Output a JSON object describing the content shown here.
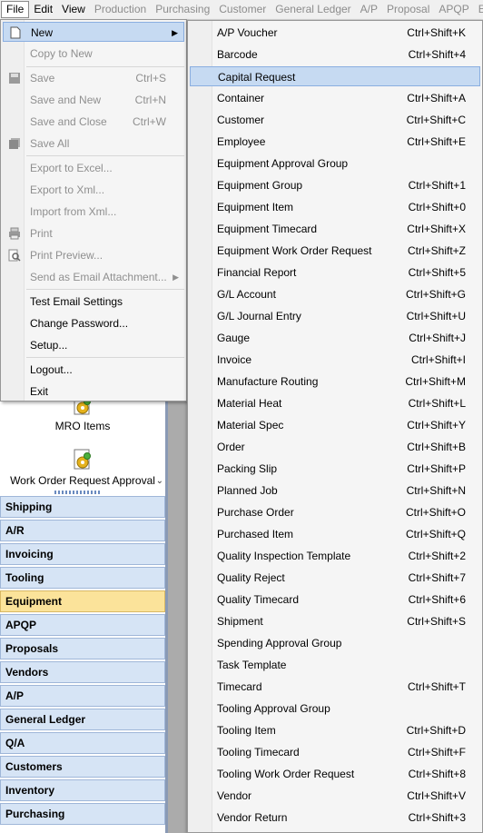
{
  "menubar": [
    "File",
    "Edit",
    "View",
    "Production",
    "Purchasing",
    "Customer",
    "General Ledger",
    "A/P",
    "Proposal",
    "APQP",
    "Eq"
  ],
  "menubar_disabled_from": 3,
  "file_menu": {
    "new": "New",
    "copy_to_new": "Copy to New",
    "save": "Save",
    "save_sc": "Ctrl+S",
    "save_new": "Save and New",
    "save_new_sc": "Ctrl+N",
    "save_close": "Save and Close",
    "save_close_sc": "Ctrl+W",
    "save_all": "Save All",
    "export_excel": "Export to Excel...",
    "export_xml": "Export to Xml...",
    "import_xml": "Import from Xml...",
    "print": "Print",
    "print_preview": "Print Preview...",
    "send_email": "Send as Email Attachment...",
    "test_email": "Test Email Settings",
    "change_password": "Change Password...",
    "setup": "Setup...",
    "logout": "Logout...",
    "exit": "Exit"
  },
  "new_submenu": [
    {
      "label": "A/P Voucher",
      "shortcut": "Ctrl+Shift+K"
    },
    {
      "label": "Barcode",
      "shortcut": "Ctrl+Shift+4"
    },
    {
      "label": "Capital Request",
      "shortcut": ""
    },
    {
      "label": "Container",
      "shortcut": "Ctrl+Shift+A"
    },
    {
      "label": "Customer",
      "shortcut": "Ctrl+Shift+C"
    },
    {
      "label": "Employee",
      "shortcut": "Ctrl+Shift+E"
    },
    {
      "label": "Equipment Approval Group",
      "shortcut": ""
    },
    {
      "label": "Equipment Group",
      "shortcut": "Ctrl+Shift+1"
    },
    {
      "label": "Equipment Item",
      "shortcut": "Ctrl+Shift+0"
    },
    {
      "label": "Equipment Timecard",
      "shortcut": "Ctrl+Shift+X"
    },
    {
      "label": "Equipment Work Order Request",
      "shortcut": "Ctrl+Shift+Z"
    },
    {
      "label": "Financial Report",
      "shortcut": "Ctrl+Shift+5"
    },
    {
      "label": "G/L Account",
      "shortcut": "Ctrl+Shift+G"
    },
    {
      "label": "G/L Journal Entry",
      "shortcut": "Ctrl+Shift+U"
    },
    {
      "label": "Gauge",
      "shortcut": "Ctrl+Shift+J"
    },
    {
      "label": "Invoice",
      "shortcut": "Ctrl+Shift+I"
    },
    {
      "label": "Manufacture Routing",
      "shortcut": "Ctrl+Shift+M"
    },
    {
      "label": "Material Heat",
      "shortcut": "Ctrl+Shift+L"
    },
    {
      "label": "Material Spec",
      "shortcut": "Ctrl+Shift+Y"
    },
    {
      "label": "Order",
      "shortcut": "Ctrl+Shift+B"
    },
    {
      "label": "Packing Slip",
      "shortcut": "Ctrl+Shift+P"
    },
    {
      "label": "Planned Job",
      "shortcut": "Ctrl+Shift+N"
    },
    {
      "label": "Purchase Order",
      "shortcut": "Ctrl+Shift+O"
    },
    {
      "label": "Purchased Item",
      "shortcut": "Ctrl+Shift+Q"
    },
    {
      "label": "Quality Inspection Template",
      "shortcut": "Ctrl+Shift+2"
    },
    {
      "label": "Quality Reject",
      "shortcut": "Ctrl+Shift+7"
    },
    {
      "label": "Quality Timecard",
      "shortcut": "Ctrl+Shift+6"
    },
    {
      "label": "Shipment",
      "shortcut": "Ctrl+Shift+S"
    },
    {
      "label": "Spending Approval Group",
      "shortcut": ""
    },
    {
      "label": "Task Template",
      "shortcut": ""
    },
    {
      "label": "Timecard",
      "shortcut": "Ctrl+Shift+T"
    },
    {
      "label": "Tooling Approval Group",
      "shortcut": ""
    },
    {
      "label": "Tooling Item",
      "shortcut": "Ctrl+Shift+D"
    },
    {
      "label": "Tooling Timecard",
      "shortcut": "Ctrl+Shift+F"
    },
    {
      "label": "Tooling Work Order Request",
      "shortcut": "Ctrl+Shift+8"
    },
    {
      "label": "Vendor",
      "shortcut": "Ctrl+Shift+V"
    },
    {
      "label": "Vendor Return",
      "shortcut": "Ctrl+Shift+3"
    }
  ],
  "new_submenu_highlighted": "Capital Request",
  "nav_tiles": {
    "mro": "MRO Items",
    "wor": "Work Order Request Approval"
  },
  "nav_sections": [
    "Shipping",
    "A/R",
    "Invoicing",
    "Tooling",
    "Equipment",
    "APQP",
    "Proposals",
    "Vendors",
    "A/P",
    "General Ledger",
    "Q/A",
    "Customers",
    "Inventory",
    "Purchasing"
  ],
  "nav_selected": "Equipment"
}
